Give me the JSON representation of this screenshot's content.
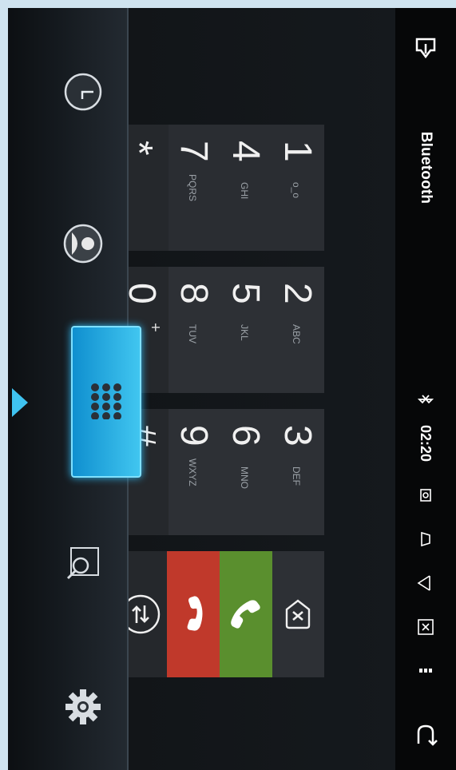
{
  "status_bar": {
    "title": "Bluetooth",
    "time": "02:20",
    "icons": [
      "exit-icon",
      "bluetooth-icon",
      "camera-icon",
      "eject-icon",
      "play-icon",
      "close-box-icon",
      "more-icon",
      "back-icon"
    ]
  },
  "keypad": {
    "keys": [
      {
        "digit": "1",
        "sub": "o_o"
      },
      {
        "digit": "2",
        "sub": "ABC"
      },
      {
        "digit": "3",
        "sub": "DEF"
      },
      {
        "digit": "4",
        "sub": "GHI"
      },
      {
        "digit": "5",
        "sub": "JKL"
      },
      {
        "digit": "6",
        "sub": "MNO"
      },
      {
        "digit": "7",
        "sub": "PQRS"
      },
      {
        "digit": "8",
        "sub": "TUV"
      },
      {
        "digit": "9",
        "sub": "WXYZ"
      },
      {
        "digit": "*",
        "sub": ""
      },
      {
        "digit": "0",
        "sub": "+"
      },
      {
        "digit": "#",
        "sub": ""
      }
    ],
    "actions": [
      "backspace-icon",
      "call-icon",
      "hangup-icon",
      "transfer-icon"
    ]
  },
  "dock": {
    "items": [
      "recents-clock-icon",
      "contacts-icon",
      "dialpad-icon",
      "search-log-icon",
      "settings-gear-icon"
    ],
    "active": "dialpad-icon"
  },
  "colors": {
    "call": "#5a8f2e",
    "hangup": "#c0392b",
    "accent": "#29aee6"
  }
}
